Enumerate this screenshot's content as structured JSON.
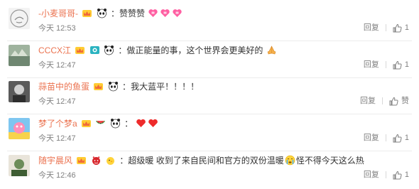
{
  "comments": [
    {
      "username": "-小麦哥哥-",
      "badges": [
        "vip-crown-badge",
        "panda-badge"
      ],
      "colon": "：",
      "text": "赞赞赞",
      "emojis_after": [
        "heart-bow-emoji",
        "heart-bow-emoji",
        "heart-bow-emoji"
      ],
      "time": "今天 12:53",
      "reply_label": "回复",
      "like_label": "1"
    },
    {
      "username": "CCCX江",
      "badges": [
        "vip-crown-badge",
        "camera-badge",
        "panda-badge"
      ],
      "colon": "：",
      "text": "做正能量的事，这个世界会更美好的",
      "emojis_after": [
        "praying-hands-emoji"
      ],
      "time": "今天 12:47",
      "reply_label": "回复",
      "like_label": "1"
    },
    {
      "username": "蒜苗中的鱼蛋",
      "badges": [
        "vip-crown-badge",
        "panda-badge"
      ],
      "colon": "：",
      "text": "我大蓝平！！！！",
      "emojis_after": [],
      "time": "今天 12:47",
      "reply_label": "回复",
      "like_label": "赞"
    },
    {
      "username": "梦了个梦a",
      "badges": [
        "vip-crown-badge",
        "watermelon-badge",
        "panda-badge"
      ],
      "colon": "：",
      "text": "",
      "emojis_after": [
        "red-heart-emoji",
        "red-heart-emoji"
      ],
      "time": "今天 12:47",
      "reply_label": "回复",
      "like_label": "1"
    },
    {
      "username": "随宇晨风",
      "badges": [
        "vip-crown-badge",
        "devil-badge",
        "chick-badge"
      ],
      "colon": "：",
      "text": "超级暖  收到了来自民间和官方的双份温暖",
      "emojis_mid": [
        "crying-face-emoji"
      ],
      "text_after": "怪不得今天这么热",
      "time": "今天 12:46",
      "reply_label": "回复",
      "like_label": "1"
    }
  ],
  "colors": {
    "username": "#eb7350",
    "text": "#333333",
    "meta": "#808080"
  }
}
